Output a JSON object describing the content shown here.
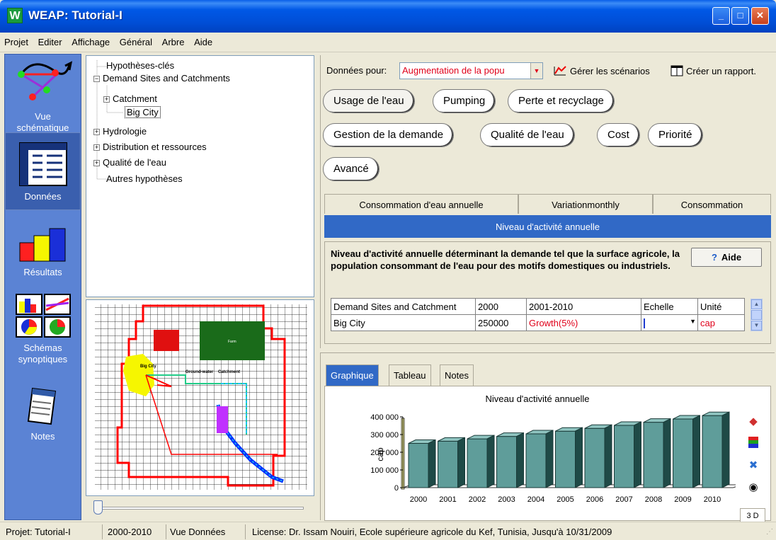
{
  "window": {
    "title": "WEAP: Tutorial-I",
    "icon_letter": "W"
  },
  "menu": [
    "Projet",
    "Editer",
    "Affichage",
    "Général",
    "Arbre",
    "Aide"
  ],
  "sidebar": {
    "items": [
      {
        "label1": "Vue",
        "label2": "schématique"
      },
      {
        "label1": "Données",
        "label2": ""
      },
      {
        "label1": "Résultats",
        "label2": ""
      },
      {
        "label1": "Schémas",
        "label2": "synoptiques"
      },
      {
        "label1": "Notes",
        "label2": ""
      }
    ]
  },
  "tree": {
    "items": [
      "Hypothèses-clés",
      "Demand Sites and Catchments",
      "Catchment",
      "Big City",
      "Hydrologie",
      "Distribution et ressources",
      "Qualité de l'eau",
      "Autres hypothèses"
    ],
    "expanders": [
      "−",
      "+",
      "+",
      "+",
      "+"
    ]
  },
  "map": {
    "labels": [
      "Big City",
      "Catchment",
      "Farm",
      "Ground-water"
    ]
  },
  "toolbar": {
    "data_for_label": "Données pour:",
    "scenario": "Augmentation de la popu",
    "manage_scenarios": "Gérer les scénarios",
    "create_report": "Créer un rapport."
  },
  "categories": [
    "Usage de l'eau",
    "Pumping",
    "Perte et recyclage",
    "Gestion de la demande",
    "Qualité de l'eau",
    "Cost",
    "Priorité",
    "Avancé"
  ],
  "tabs": [
    "Consommation d'eau annuelle",
    "Variationmonthly",
    "Consommation"
  ],
  "active_variable": "Niveau d'activité annuelle",
  "description": "Niveau d'activité annuelle déterminant la demande tel que la surface agricole, la population consommant de l'eau pour des motifs domestiques ou industriels.",
  "help_label": "Aide",
  "table": {
    "headers": [
      "Demand Sites and Catchment",
      "2000",
      "2001-2010",
      "Echelle",
      "Unité"
    ],
    "row": {
      "name": "Big City",
      "base": "250000",
      "expression": "Growth(5%)",
      "scale": "",
      "unit": "cap"
    }
  },
  "chart_tabs": [
    "Graphique",
    "Tableau",
    "Notes"
  ],
  "button_3d": "3 D",
  "chart_data": {
    "type": "bar",
    "title": "Niveau d'activité annuelle",
    "ylabel": "cap",
    "xlabel": "",
    "categories": [
      "2000",
      "2001",
      "2002",
      "2003",
      "2004",
      "2005",
      "2006",
      "2007",
      "2008",
      "2009",
      "2010"
    ],
    "values": [
      250000,
      262500,
      275625,
      289406,
      303877,
      319070,
      335024,
      351775,
      369364,
      387832,
      407224
    ],
    "yticks": [
      "400 000",
      "300 000",
      "200 000",
      "100 000",
      "0"
    ],
    "ylim": [
      0,
      400000
    ],
    "bar_color": "#5f9d9a"
  },
  "status": {
    "project": "Projet: Tutorial-I",
    "years": "2000-2010",
    "view": "Vue Données",
    "license": "License: Dr. Issam Nouiri, Ecole supérieure agricole du Kef, Tunisia, Jusqu'à 10/31/2009"
  }
}
